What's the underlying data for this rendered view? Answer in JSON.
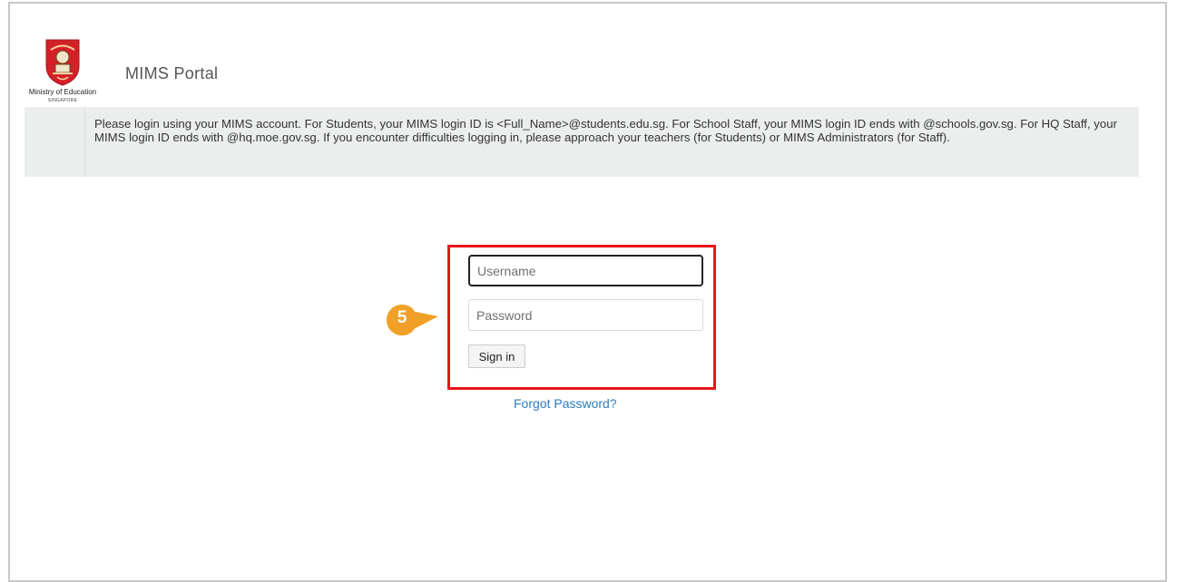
{
  "header": {
    "logo_ministry": "Ministry of Education",
    "logo_country": "SINGAPORE",
    "portal_title": "MIMS Portal"
  },
  "notice": {
    "text": "Please login using your MIMS account. For Students, your MIMS login ID is <Full_Name>@students.edu.sg. For School Staff, your MIMS login ID ends with @schools.gov.sg. For HQ Staff, your MIMS login ID ends with @hq.moe.gov.sg. If you encounter difficulties logging in, please approach your teachers (for Students) or MIMS Administrators (for Staff)."
  },
  "login_form": {
    "username_placeholder": "Username",
    "username_value": "",
    "password_placeholder": "Password",
    "password_value": "",
    "signin_label": "Sign in",
    "forgot_label": "Forgot Password?"
  },
  "annotation": {
    "step_number": "5",
    "marker_color": "#f0a026",
    "highlight_color": "#e8141c"
  },
  "colors": {
    "link": "#2a7bc0",
    "notice_background": "#eceeee",
    "logo_red": "#d42027"
  },
  "icons": {
    "logo": "moe-crest-icon",
    "marker": "step-marker-icon"
  }
}
